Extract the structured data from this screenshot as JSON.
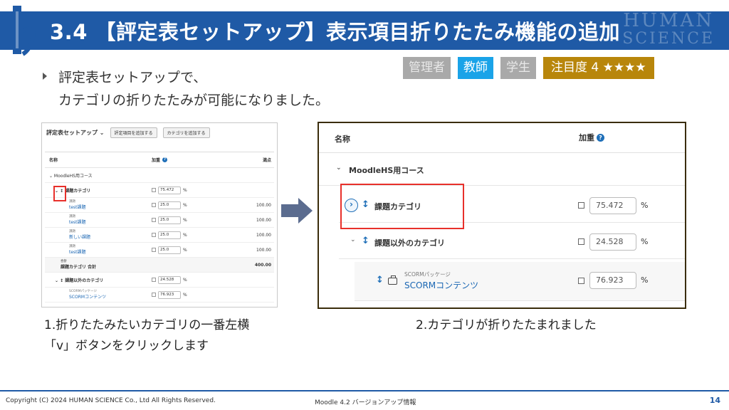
{
  "header": {
    "title": "3.4 【評定表セットアップ】表示項目折りたたみ機能の追加",
    "brand_top": "HUMAN",
    "brand_bottom": "SCIENCE"
  },
  "badges": {
    "admin": "管理者",
    "teacher": "教師",
    "student": "学生",
    "attention": "注目度 4 ★★★★"
  },
  "bullet": {
    "line1": "評定表セットアップで、",
    "line2": "カテゴリの折りたたみが可能になりました。"
  },
  "left_shot": {
    "title": "評定表セットアップ ⌄",
    "btn_add_item": "評定項目を追加する",
    "btn_add_category": "カテゴリを追加する",
    "col_name": "名称",
    "col_weight": "加重",
    "col_total": "満点",
    "course": "⌄ MoodleHS用コース",
    "rows": [
      {
        "name": "⌄ ↕ 課題カテゴリ",
        "weight": "75.472",
        "pct": "%",
        "total": ""
      },
      {
        "sub": "課題",
        "name": "test課題",
        "weight": "25.0",
        "pct": "%",
        "total": "100.00"
      },
      {
        "sub": "課題",
        "name": "test課題",
        "weight": "25.0",
        "pct": "%",
        "total": "100.00"
      },
      {
        "sub": "課題",
        "name": "新しい課題",
        "weight": "25.0",
        "pct": "%",
        "total": "100.00"
      },
      {
        "sub": "課題",
        "name": "test課題",
        "weight": "25.0",
        "pct": "%",
        "total": "100.00"
      },
      {
        "sub": "合計",
        "name": "課題カテゴリ 合計",
        "weight": "",
        "pct": "",
        "total": "400.00"
      },
      {
        "name": "⌄ ↕ 課題以外のカテゴリ",
        "weight": "24.528",
        "pct": "%",
        "total": ""
      },
      {
        "sub": "SCORMパッケージ",
        "name": "SCORMコンテンツ",
        "weight": "76.923",
        "pct": "%",
        "total": ""
      }
    ]
  },
  "right_shot": {
    "col_name": "名称",
    "col_weight": "加重",
    "help": "?",
    "course_chev": "⌄",
    "course": "MoodleHS用コース",
    "cat1_name": "課題カテゴリ",
    "cat1_weight": "75.472",
    "cat2_chev": "⌄",
    "cat2_name": "課題以外のカテゴリ",
    "cat2_weight": "24.528",
    "item_sub": "SCORMパッケージ",
    "item_name": "SCORMコンテンツ",
    "item_weight": "76.923",
    "pct": "%",
    "expand_glyph": "›",
    "move_glyph": "↕"
  },
  "captions": {
    "left_line1": "1.折りたたみたいカテゴリの一番左横",
    "left_line2": "「v」ボタンをクリックします",
    "right": "2.カテゴリが折りたたまれました"
  },
  "footer": {
    "copyright": "Copyright (C) 2024 HUMAN SCIENCE Co., Ltd All Rights Reserved.",
    "mid": "Moodle 4.2 バージョンアップ情報",
    "page": "14"
  },
  "colors": {
    "header": "#1f5aa6",
    "teacher_badge": "#1aa3e8",
    "attention_badge": "#b8860b",
    "highlight": "#e8302b",
    "link": "#1a66b3"
  },
  "icons": [
    "move-icon",
    "expand-icon",
    "help-icon",
    "quiz-icon",
    "chevron-down-icon",
    "arrow-right-icon",
    "bullet-arrow-icon"
  ]
}
